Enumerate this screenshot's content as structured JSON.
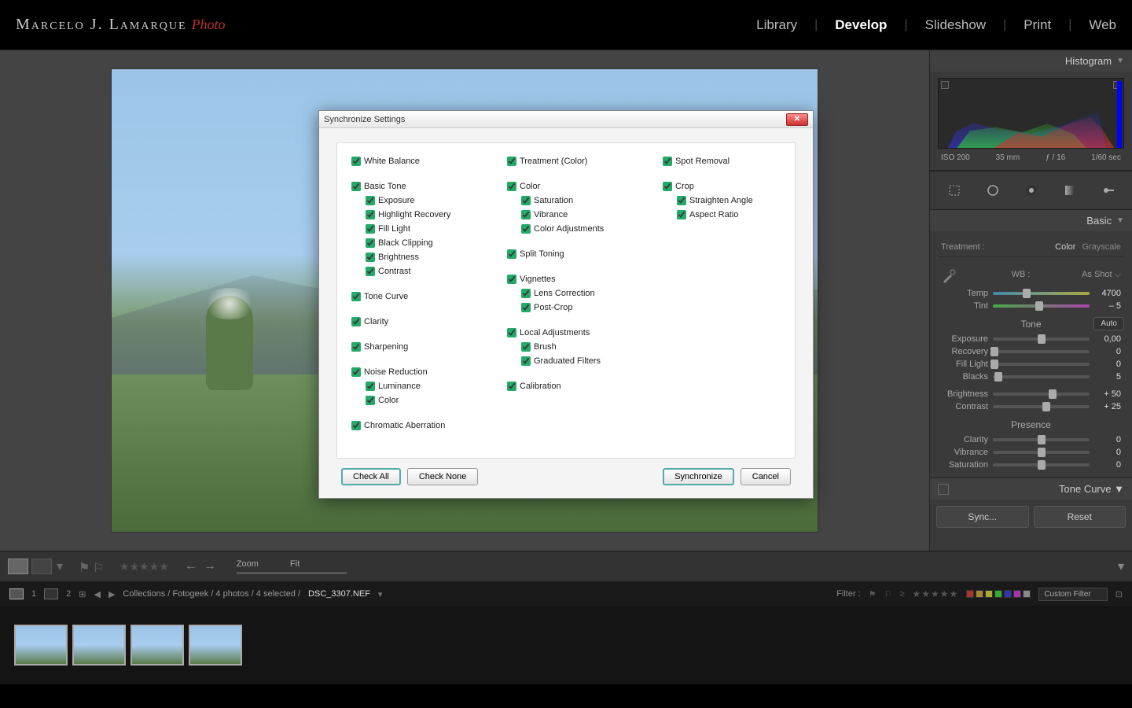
{
  "identity": {
    "name": "Marcelo J. Lamarque",
    "tag": "Photo"
  },
  "modules": [
    "Library",
    "Develop",
    "Slideshow",
    "Print",
    "Web"
  ],
  "active_module": "Develop",
  "histogram": {
    "title": "Histogram",
    "exif": {
      "iso": "ISO 200",
      "focal": "35 mm",
      "aperture": "ƒ / 16",
      "shutter": "1/60 sec"
    }
  },
  "tools": [
    "crop-icon",
    "spot-icon",
    "redeye-icon",
    "grad-icon",
    "brush-icon"
  ],
  "basic": {
    "title": "Basic",
    "treatment_label": "Treatment :",
    "treatment_color": "Color",
    "treatment_grayscale": "Grayscale",
    "wb_label": "WB :",
    "wb_value": "As Shot",
    "temp_label": "Temp",
    "temp_value": "4700",
    "tint_label": "Tint",
    "tint_value": "– 5",
    "tone_label": "Tone",
    "auto_label": "Auto",
    "sliders": [
      {
        "label": "Exposure",
        "value": "0,00",
        "pos": 50
      },
      {
        "label": "Recovery",
        "value": "0",
        "pos": 2
      },
      {
        "label": "Fill Light",
        "value": "0",
        "pos": 2
      },
      {
        "label": "Blacks",
        "value": "5",
        "pos": 6
      }
    ],
    "brightness_label": "Brightness",
    "brightness_value": "+ 50",
    "contrast_label": "Contrast",
    "contrast_value": "+ 25",
    "presence_label": "Presence",
    "presence": [
      {
        "label": "Clarity",
        "value": "0",
        "pos": 50
      },
      {
        "label": "Vibrance",
        "value": "0",
        "pos": 50
      },
      {
        "label": "Saturation",
        "value": "0",
        "pos": 50
      }
    ]
  },
  "tone_curve_title": "Tone Curve",
  "sync_btn": "Sync...",
  "reset_btn": "Reset",
  "toolbar": {
    "zoom_label": "Zoom",
    "fit_label": "Fit"
  },
  "filmstrip": {
    "crumb": "Collections / Fotogeek / 4 photos / 4 selected /",
    "filename": "DSC_3307.NEF",
    "filter_label": "Filter :",
    "custom_filter": "Custom Filter",
    "page_1": "1",
    "page_2": "2"
  },
  "color_labels": [
    "#a33",
    "#a83",
    "#aa3",
    "#3a3",
    "#33a",
    "#a3a",
    "#888"
  ],
  "dialog": {
    "title": "Synchronize Settings",
    "col1": [
      {
        "label": "White Balance"
      },
      {
        "label": "Basic Tone",
        "children": [
          "Exposure",
          "Highlight Recovery",
          "Fill Light",
          "Black Clipping",
          "Brightness",
          "Contrast"
        ]
      },
      {
        "label": "Tone Curve"
      },
      {
        "label": "Clarity"
      },
      {
        "label": "Sharpening"
      },
      {
        "label": "Noise Reduction",
        "children": [
          "Luminance",
          "Color"
        ]
      },
      {
        "label": "Chromatic Aberration"
      }
    ],
    "col2": [
      {
        "label": "Treatment (Color)"
      },
      {
        "label": "Color",
        "children": [
          "Saturation",
          "Vibrance",
          "Color Adjustments"
        ]
      },
      {
        "label": "Split Toning"
      },
      {
        "label": "Vignettes",
        "children": [
          "Lens Correction",
          "Post-Crop"
        ]
      },
      {
        "label": "Local Adjustments",
        "children": [
          "Brush",
          "Graduated Filters"
        ]
      },
      {
        "label": "Calibration"
      }
    ],
    "col3": [
      {
        "label": "Spot Removal"
      },
      {
        "label": "Crop",
        "children": [
          "Straighten Angle",
          "Aspect Ratio"
        ]
      }
    ],
    "check_all": "Check All",
    "check_none": "Check None",
    "synchronize": "Synchronize",
    "cancel": "Cancel"
  }
}
